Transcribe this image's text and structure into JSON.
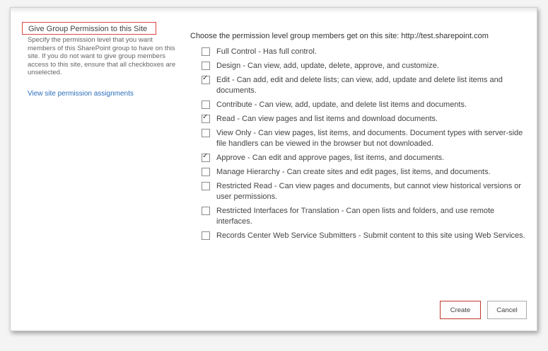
{
  "left": {
    "section_title": "Give Group Permission to this Site",
    "section_description": "Specify the permission level that you want members of this SharePoint group to have on this site. If you do not want to give group members access to this site, ensure that all checkboxes are unselected.",
    "permission_link": "View site permission assignments"
  },
  "right": {
    "intro": "Choose the permission level group members get on this site: http://test.sharepoint.com",
    "permissions": [
      {
        "label": "Full Control - Has full control.",
        "checked": false
      },
      {
        "label": "Design - Can view, add, update, delete, approve, and customize.",
        "checked": false
      },
      {
        "label": "Edit - Can add, edit and delete lists; can view, add, update and delete list items and documents.",
        "checked": true
      },
      {
        "label": "Contribute - Can view, add, update, and delete list items and documents.",
        "checked": false
      },
      {
        "label": "Read - Can view pages and list items and download documents.",
        "checked": true
      },
      {
        "label": "View Only - Can view pages, list items, and documents. Document types with server-side file handlers can be viewed in the browser but not downloaded.",
        "checked": false
      },
      {
        "label": "Approve - Can edit and approve pages, list items, and documents.",
        "checked": true
      },
      {
        "label": "Manage Hierarchy - Can create sites and edit pages, list items, and documents.",
        "checked": false
      },
      {
        "label": "Restricted Read - Can view pages and documents, but cannot view historical versions or user permissions.",
        "checked": false
      },
      {
        "label": "Restricted Interfaces for Translation - Can open lists and folders, and use remote interfaces.",
        "checked": false
      },
      {
        "label": "Records Center Web Service Submitters - Submit content to this site using Web Services.",
        "checked": false
      }
    ]
  },
  "buttons": {
    "create": "Create",
    "cancel": "Cancel"
  }
}
